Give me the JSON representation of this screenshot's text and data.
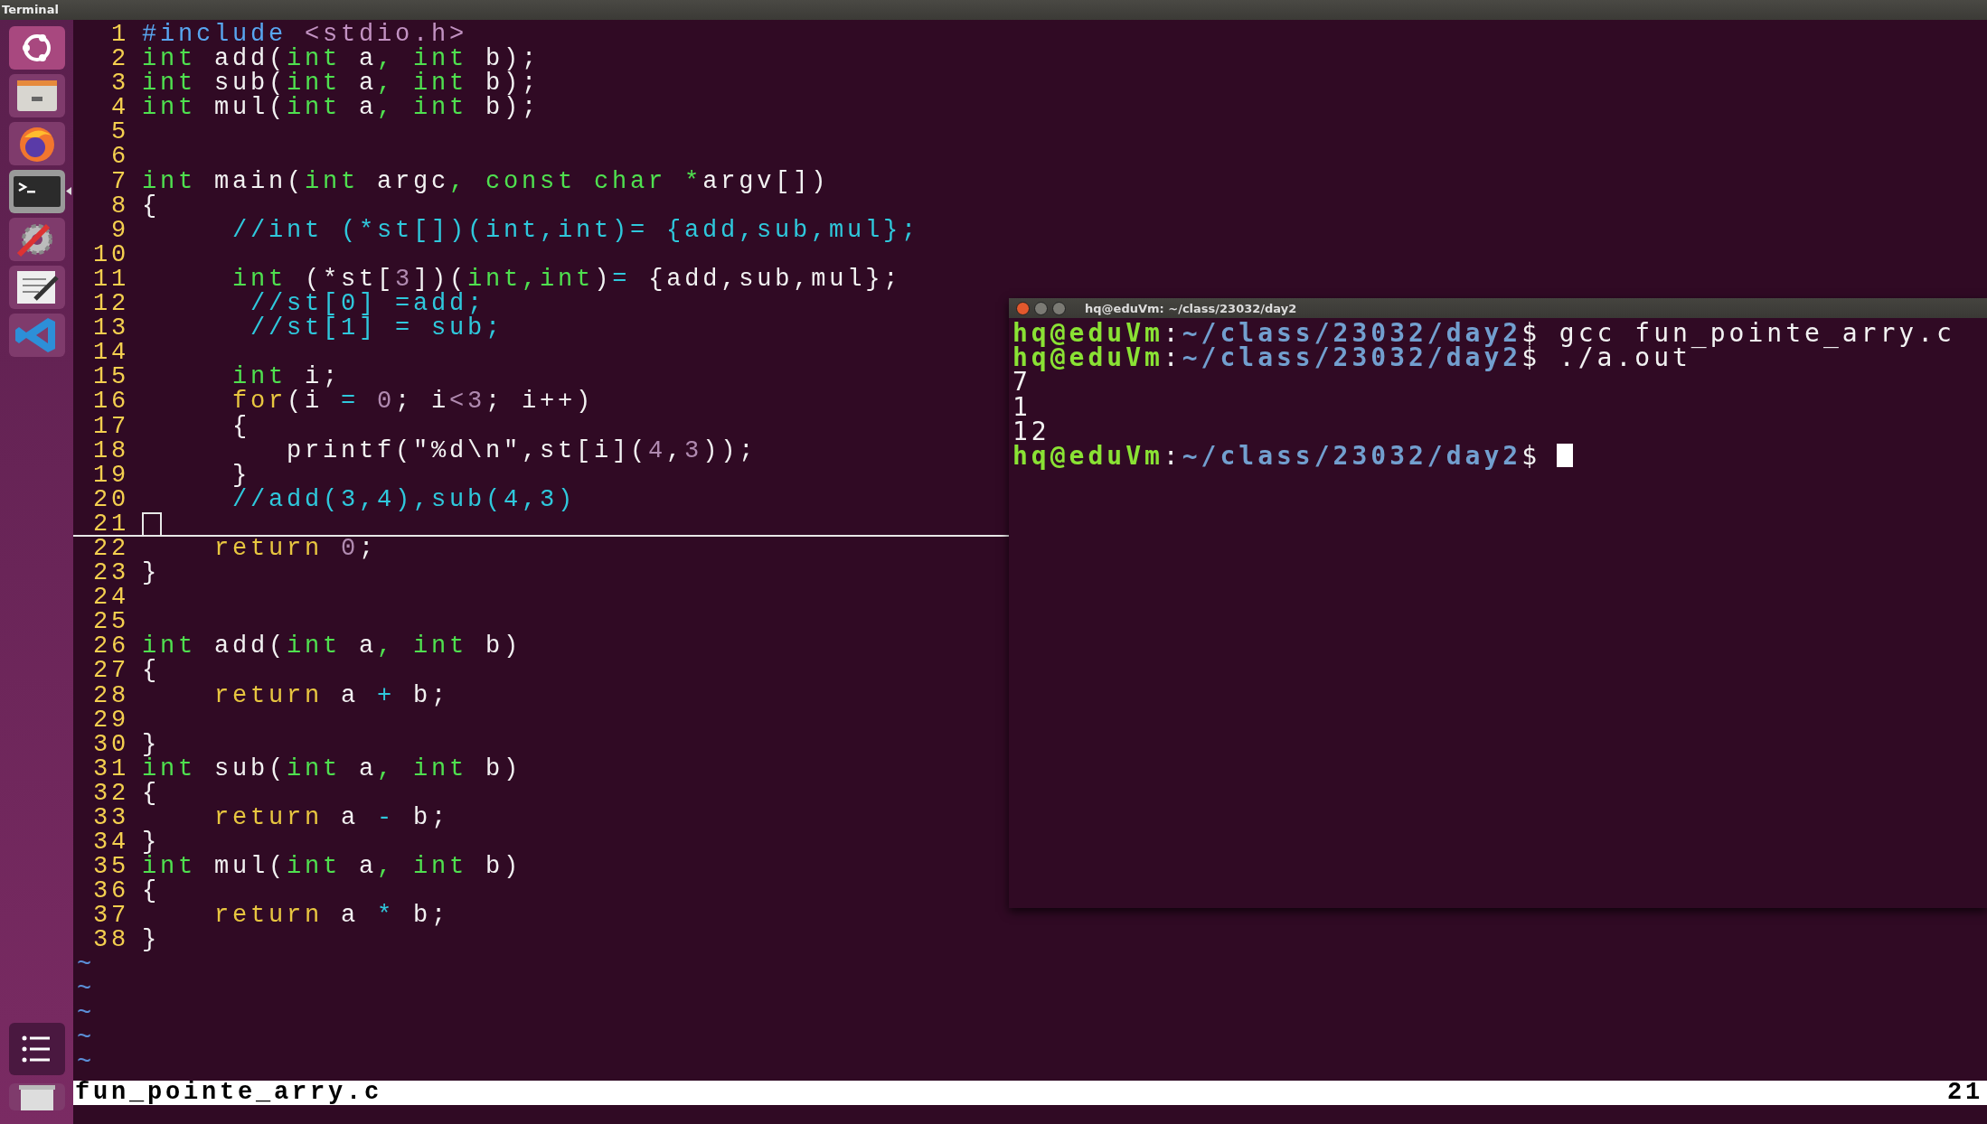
{
  "top_bar": {
    "title": "Terminal"
  },
  "launcher": {
    "items": [
      {
        "kind": "dash",
        "running": false
      },
      {
        "kind": "files",
        "running": false
      },
      {
        "kind": "firefox",
        "running": false
      },
      {
        "kind": "terminal",
        "running": true
      },
      {
        "kind": "settings",
        "running": false
      },
      {
        "kind": "editor",
        "running": false
      },
      {
        "kind": "vscode",
        "running": false
      }
    ],
    "bottom_items": [
      {
        "kind": "menu",
        "running": false
      },
      {
        "kind": "trash",
        "running": false
      }
    ]
  },
  "editor": {
    "lines": [
      {
        "number": "1",
        "current": false,
        "tokens": [
          {
            "text": "#include",
            "kind": "pre"
          },
          {
            "text": " <stdio.h>",
            "kind": "str"
          }
        ]
      },
      {
        "number": "2",
        "current": false,
        "tokens": [
          {
            "text": "int",
            "kind": "kw"
          },
          {
            "text": " add(",
            "kind": "plain"
          },
          {
            "text": "int",
            "kind": "kw"
          },
          {
            "text": " a",
            "kind": "plain"
          },
          {
            "text": ", ",
            "kind": "kw"
          },
          {
            "text": "int",
            "kind": "kw"
          },
          {
            "text": " b);",
            "kind": "plain"
          }
        ]
      },
      {
        "number": "3",
        "current": false,
        "tokens": [
          {
            "text": "int",
            "kind": "kw"
          },
          {
            "text": " sub(",
            "kind": "plain"
          },
          {
            "text": "int",
            "kind": "kw"
          },
          {
            "text": " a",
            "kind": "plain"
          },
          {
            "text": ", ",
            "kind": "kw"
          },
          {
            "text": "int",
            "kind": "kw"
          },
          {
            "text": " b);",
            "kind": "plain"
          }
        ]
      },
      {
        "number": "4",
        "current": false,
        "tokens": [
          {
            "text": "int",
            "kind": "kw"
          },
          {
            "text": " mul(",
            "kind": "plain"
          },
          {
            "text": "int",
            "kind": "kw"
          },
          {
            "text": " a",
            "kind": "plain"
          },
          {
            "text": ", ",
            "kind": "kw"
          },
          {
            "text": "int",
            "kind": "kw"
          },
          {
            "text": " b);",
            "kind": "plain"
          }
        ]
      },
      {
        "number": "5",
        "current": false
      },
      {
        "number": "6",
        "current": false
      },
      {
        "number": "7",
        "current": false,
        "tokens": [
          {
            "text": "int",
            "kind": "kw"
          },
          {
            "text": " main(",
            "kind": "plain"
          },
          {
            "text": "int",
            "kind": "kw"
          },
          {
            "text": " argc",
            "kind": "plain"
          },
          {
            "text": ", const char *",
            "kind": "kw"
          },
          {
            "text": "argv[])",
            "kind": "plain"
          }
        ]
      },
      {
        "number": "8",
        "current": false,
        "tokens": [
          {
            "text": "{",
            "kind": "plain"
          }
        ]
      },
      {
        "number": "9",
        "current": false,
        "tokens": [
          {
            "text": "     //int (*st[])(int,int)= {add,sub,mul};",
            "kind": "comment"
          }
        ]
      },
      {
        "number": "10",
        "current": false
      },
      {
        "number": "11",
        "current": false,
        "tokens": [
          {
            "text": "     int",
            "kind": "kw"
          },
          {
            "text": " (*st[",
            "kind": "plain"
          },
          {
            "text": "3",
            "kind": "num"
          },
          {
            "text": "])(",
            "kind": "plain"
          },
          {
            "text": "int,int",
            "kind": "kw"
          },
          {
            "text": ")",
            "kind": "plain"
          },
          {
            "text": "=",
            "kind": "op"
          },
          {
            "text": " {add,sub,mul};",
            "kind": "plain"
          }
        ]
      },
      {
        "number": "12",
        "current": false,
        "tokens": [
          {
            "text": "      //st[0] =add;",
            "kind": "comment"
          }
        ]
      },
      {
        "number": "13",
        "current": false,
        "tokens": [
          {
            "text": "      //st[1] = sub;",
            "kind": "comment"
          }
        ]
      },
      {
        "number": "14",
        "current": false
      },
      {
        "number": "15",
        "current": false,
        "tokens": [
          {
            "text": "     int",
            "kind": "kw"
          },
          {
            "text": " i;",
            "kind": "plain"
          }
        ]
      },
      {
        "number": "16",
        "current": false,
        "tokens": [
          {
            "text": "     for",
            "kind": "ctl"
          },
          {
            "text": "(i ",
            "kind": "plain"
          },
          {
            "text": "=",
            "kind": "op"
          },
          {
            "text": " 0",
            "kind": "num"
          },
          {
            "text": "; i",
            "kind": "plain"
          },
          {
            "text": "<3",
            "kind": "num"
          },
          {
            "text": "; i++)",
            "kind": "plain"
          }
        ]
      },
      {
        "number": "17",
        "current": false,
        "tokens": [
          {
            "text": "     {",
            "kind": "plain"
          }
        ]
      },
      {
        "number": "18",
        "current": false,
        "tokens": [
          {
            "text": "        printf(\"%d\\n\",st[i](",
            "kind": "plain"
          },
          {
            "text": "4",
            "kind": "num"
          },
          {
            "text": ",",
            "kind": "plain"
          },
          {
            "text": "3",
            "kind": "num"
          },
          {
            "text": "));",
            "kind": "plain"
          }
        ]
      },
      {
        "number": "19",
        "current": false,
        "tokens": [
          {
            "text": "     }",
            "kind": "plain"
          }
        ]
      },
      {
        "number": "20",
        "current": false,
        "tokens": [
          {
            "text": "     //add(3,4),sub(4,3)",
            "kind": "comment"
          }
        ]
      },
      {
        "number": "21",
        "current": true
      },
      {
        "number": "22",
        "current": false,
        "tokens": [
          {
            "text": "    return",
            "kind": "ctl"
          },
          {
            "text": " 0",
            "kind": "num"
          },
          {
            "text": ";",
            "kind": "plain"
          }
        ]
      },
      {
        "number": "23",
        "current": false,
        "tokens": [
          {
            "text": "}",
            "kind": "plain"
          }
        ]
      },
      {
        "number": "24",
        "current": false
      },
      {
        "number": "25",
        "current": false
      },
      {
        "number": "26",
        "current": false,
        "tokens": [
          {
            "text": "int",
            "kind": "kw"
          },
          {
            "text": " add(",
            "kind": "plain"
          },
          {
            "text": "int",
            "kind": "kw"
          },
          {
            "text": " a",
            "kind": "plain"
          },
          {
            "text": ", ",
            "kind": "kw"
          },
          {
            "text": "int",
            "kind": "kw"
          },
          {
            "text": " b)",
            "kind": "plain"
          }
        ]
      },
      {
        "number": "27",
        "current": false,
        "tokens": [
          {
            "text": "{",
            "kind": "plain"
          }
        ]
      },
      {
        "number": "28",
        "current": false,
        "tokens": [
          {
            "text": "    return",
            "kind": "ctl"
          },
          {
            "text": " a ",
            "kind": "plain"
          },
          {
            "text": "+",
            "kind": "op"
          },
          {
            "text": " b;",
            "kind": "plain"
          }
        ]
      },
      {
        "number": "29",
        "current": false
      },
      {
        "number": "30",
        "current": false,
        "tokens": [
          {
            "text": "}",
            "kind": "plain"
          }
        ]
      },
      {
        "number": "31",
        "current": false,
        "tokens": [
          {
            "text": "int",
            "kind": "kw"
          },
          {
            "text": " sub(",
            "kind": "plain"
          },
          {
            "text": "int",
            "kind": "kw"
          },
          {
            "text": " a",
            "kind": "plain"
          },
          {
            "text": ", ",
            "kind": "kw"
          },
          {
            "text": "int",
            "kind": "kw"
          },
          {
            "text": " b)",
            "kind": "plain"
          }
        ]
      },
      {
        "number": "32",
        "current": false,
        "tokens": [
          {
            "text": "{",
            "kind": "plain"
          }
        ]
      },
      {
        "number": "33",
        "current": false,
        "tokens": [
          {
            "text": "    return",
            "kind": "ctl"
          },
          {
            "text": " a ",
            "kind": "plain"
          },
          {
            "text": "-",
            "kind": "op"
          },
          {
            "text": " b;",
            "kind": "plain"
          }
        ]
      },
      {
        "number": "34",
        "current": false,
        "tokens": [
          {
            "text": "}",
            "kind": "plain"
          }
        ]
      },
      {
        "number": "35",
        "current": false,
        "tokens": [
          {
            "text": "int",
            "kind": "kw"
          },
          {
            "text": " mul(",
            "kind": "plain"
          },
          {
            "text": "int",
            "kind": "kw"
          },
          {
            "text": " a",
            "kind": "plain"
          },
          {
            "text": ", ",
            "kind": "kw"
          },
          {
            "text": "int",
            "kind": "kw"
          },
          {
            "text": " b)",
            "kind": "plain"
          }
        ]
      },
      {
        "number": "36",
        "current": false,
        "tokens": [
          {
            "text": "{",
            "kind": "plain"
          }
        ]
      },
      {
        "number": "37",
        "current": false,
        "tokens": [
          {
            "text": "    return",
            "kind": "ctl"
          },
          {
            "text": " a ",
            "kind": "plain"
          },
          {
            "text": "*",
            "kind": "op"
          },
          {
            "text": " b;",
            "kind": "plain"
          }
        ]
      },
      {
        "number": "38",
        "current": false,
        "tokens": [
          {
            "text": "}",
            "kind": "plain"
          }
        ]
      }
    ],
    "filler": [
      "~",
      "~",
      "~",
      "~",
      "~"
    ],
    "status_bar": {
      "file_name": "fun_pointe_arry.c",
      "line": "21"
    }
  },
  "terminal": {
    "title": "hq@eduVm: ~/class/23032/day2",
    "lines": [
      {
        "cursor": false,
        "tokens": [
          {
            "text": "hq@eduVm",
            "kind": "user"
          },
          {
            "text": ":",
            "kind": "plain"
          },
          {
            "text": "~/class/23032/day2",
            "kind": "path"
          },
          {
            "text": "$ gcc fun_pointe_arry.c",
            "kind": "plain"
          }
        ]
      },
      {
        "cursor": false,
        "tokens": [
          {
            "text": "hq@eduVm",
            "kind": "user"
          },
          {
            "text": ":",
            "kind": "plain"
          },
          {
            "text": "~/class/23032/day2",
            "kind": "path"
          },
          {
            "text": "$ ./a.out",
            "kind": "plain"
          }
        ]
      },
      {
        "cursor": false,
        "tokens": [
          {
            "text": "7",
            "kind": "plain"
          }
        ]
      },
      {
        "cursor": false,
        "tokens": [
          {
            "text": "1",
            "kind": "plain"
          }
        ]
      },
      {
        "cursor": false,
        "tokens": [
          {
            "text": "12",
            "kind": "plain"
          }
        ]
      },
      {
        "cursor": true,
        "tokens": [
          {
            "text": "hq@eduVm",
            "kind": "user"
          },
          {
            "text": ":",
            "kind": "plain"
          },
          {
            "text": "~/class/23032/day2",
            "kind": "path"
          },
          {
            "text": "$",
            "kind": "plain"
          }
        ]
      }
    ]
  }
}
